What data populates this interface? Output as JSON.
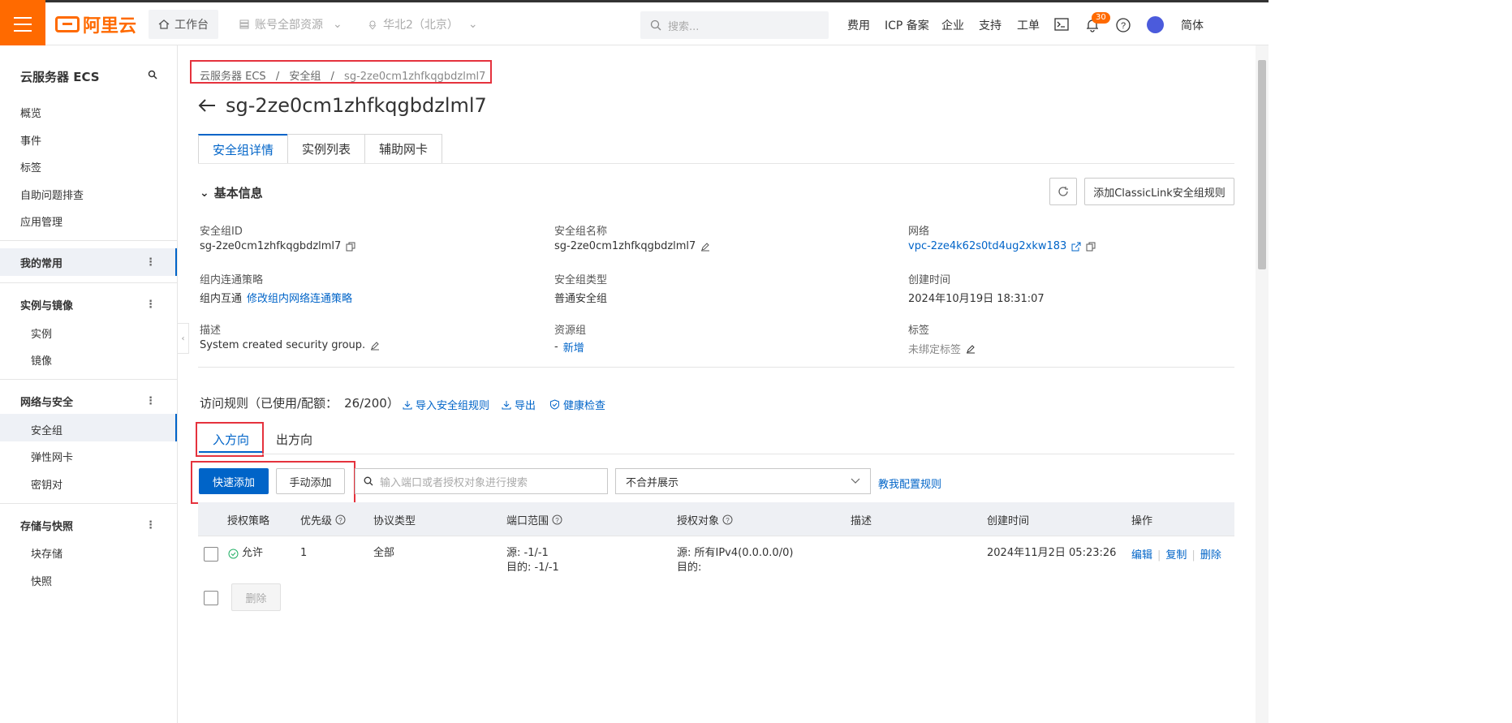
{
  "topbar": {
    "logo_text": "阿里云",
    "workbench": "工作台",
    "account_resources": "账号全部资源",
    "region": "华北2（北京）",
    "search_placeholder": "搜索...",
    "links": [
      "费用",
      "ICP 备案",
      "企业",
      "支持",
      "工单"
    ],
    "notification_count": "30",
    "lang": "简体"
  },
  "sidebar": {
    "title": "云服务器 ECS",
    "top_items": [
      "概览",
      "事件",
      "标签",
      "自助问题排查",
      "应用管理"
    ],
    "favorites": "我的常用",
    "groups": [
      {
        "label": "实例与镜像",
        "items": [
          "实例",
          "镜像"
        ]
      },
      {
        "label": "网络与安全",
        "items": [
          "安全组",
          "弹性网卡",
          "密钥对"
        ]
      },
      {
        "label": "存储与快照",
        "items": [
          "块存储",
          "快照"
        ]
      }
    ]
  },
  "breadcrumb": {
    "items": [
      "云服务器 ECS",
      "安全组",
      "sg-2ze0cm1zhfkqgbdzlml7"
    ],
    "sep": "/"
  },
  "page_title": "sg-2ze0cm1zhfkqgbdzlml7",
  "tabs": [
    "安全组详情",
    "实例列表",
    "辅助网卡"
  ],
  "basic_info": {
    "title": "基本信息",
    "add_classiclink_button": "添加ClassicLink安全组规则",
    "fields": {
      "sg_id_label": "安全组ID",
      "sg_id": "sg-2ze0cm1zhfkqgbdzlml7",
      "sg_name_label": "安全组名称",
      "sg_name": "sg-2ze0cm1zhfkqgbdzlml7",
      "network_label": "网络",
      "network": "vpc-2ze4k62s0td4ug2xkw183",
      "intra_policy_label": "组内连通策略",
      "intra_policy": "组内互通",
      "intra_policy_link": "修改组内网络连通策略",
      "sg_type_label": "安全组类型",
      "sg_type": "普通安全组",
      "created_label": "创建时间",
      "created": "2024年10月19日 18:31:07",
      "desc_label": "描述",
      "desc": "System created security group.",
      "resource_group_label": "资源组",
      "resource_group_dash": "-",
      "resource_group_link": "新增",
      "tags_label": "标签",
      "tags": "未绑定标签"
    }
  },
  "rules": {
    "title": "访问规则（已使用/配额：",
    "quota": "26/200）",
    "import_link": "导入安全组规则",
    "export_link": "导出",
    "health_link": "健康检查",
    "direction_tabs": [
      "入方向",
      "出方向"
    ],
    "quick_add": "快速添加",
    "manual_add": "手动添加",
    "search_placeholder": "输入端口或者授权对象进行搜索",
    "display_select": "不合并展示",
    "teach_link": "教我配置规则",
    "columns": [
      "授权策略",
      "优先级",
      "协议类型",
      "端口范围",
      "授权对象",
      "描述",
      "创建时间",
      "操作"
    ],
    "rows": [
      {
        "policy": "允许",
        "priority": "1",
        "protocol": "全部",
        "port_src": "源: -1/-1",
        "port_dst": "目的: -1/-1",
        "auth_src": "源: 所有IPv4(0.0.0.0/0)",
        "auth_dst": "目的:",
        "desc": "",
        "created": "2024年11月2日 05:23:26",
        "actions": [
          "编辑",
          "复制",
          "删除"
        ]
      }
    ],
    "batch_delete": "删除"
  }
}
